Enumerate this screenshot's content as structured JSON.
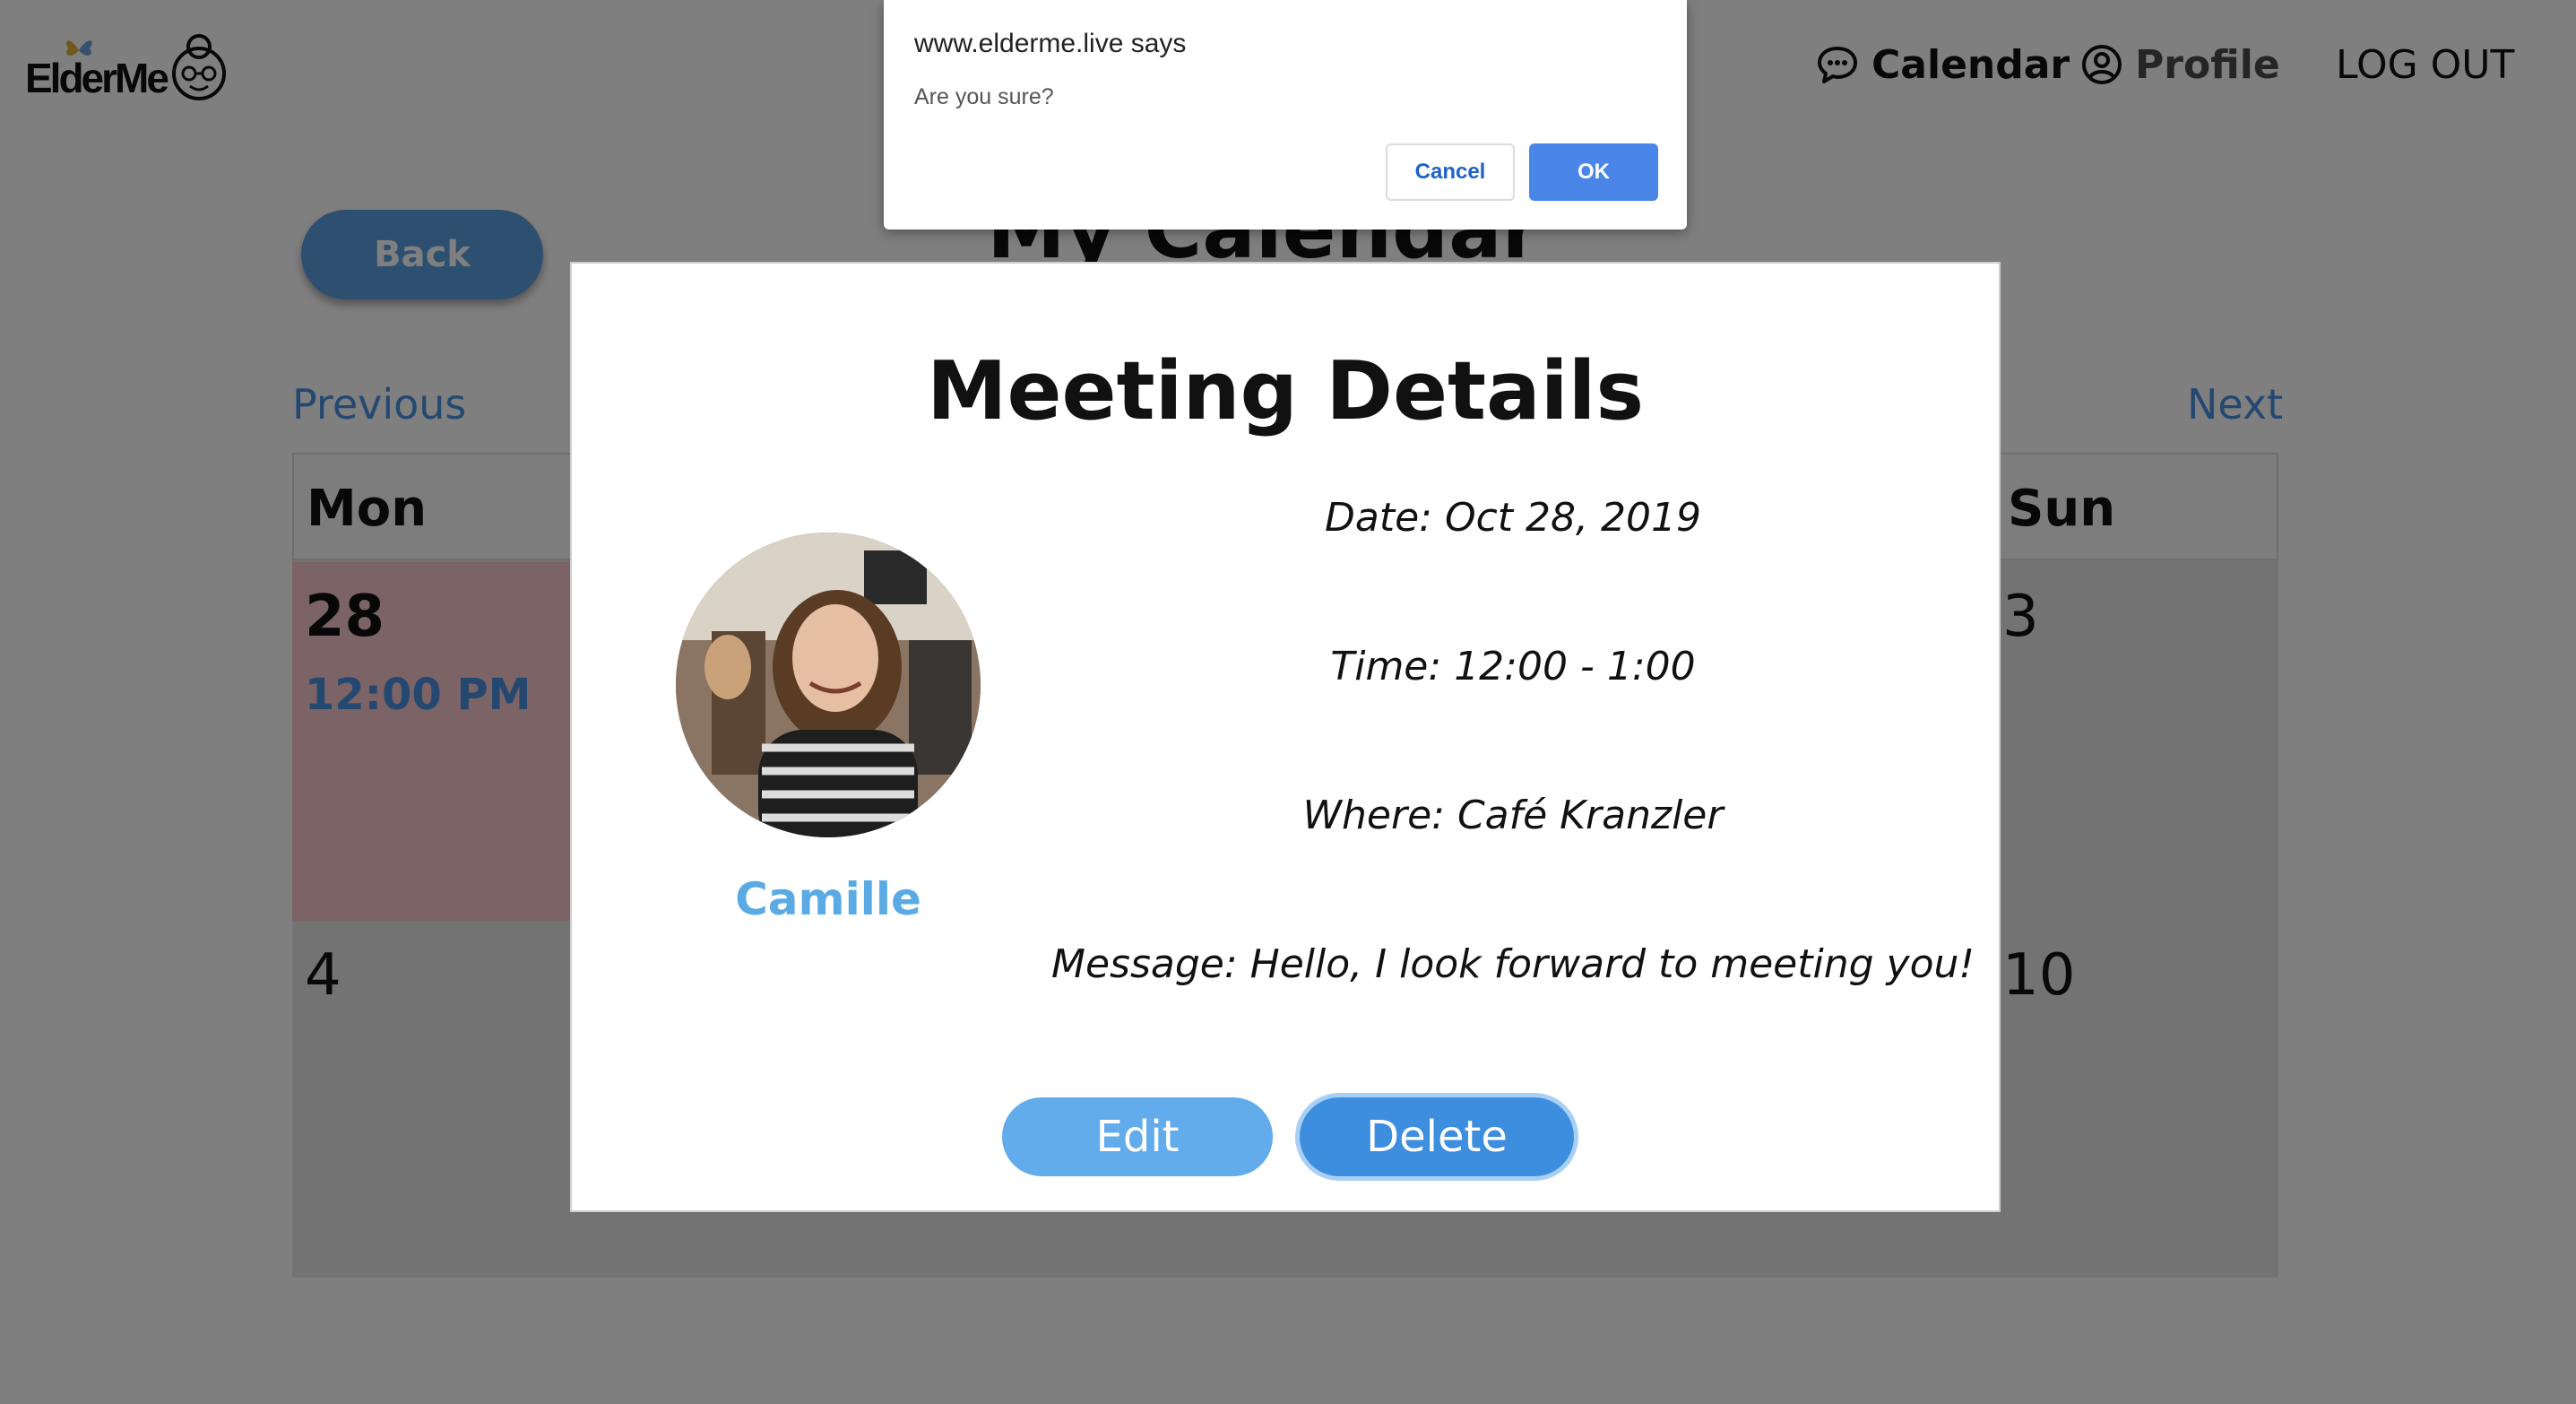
{
  "header": {
    "logo_text": "ElderMe",
    "nav": {
      "calendar_label": "Calendar",
      "profile_label": "Profile",
      "logout_label": "LOG OUT"
    }
  },
  "page": {
    "back_label": "Back",
    "title": "My Calendar",
    "prev_label": "Previous",
    "next_label": "Next"
  },
  "calendar": {
    "day_headers": [
      "Mon",
      "Sun"
    ],
    "cells": {
      "today_num": "28",
      "today_event": "12:00 PM",
      "sun1_num": "3",
      "mon2_num": "4",
      "sun2_num": "10"
    },
    "colors": {
      "today_bg": "#f7c6cc",
      "event": "#4a90e2"
    }
  },
  "modal": {
    "title": "Meeting Details",
    "person_name": "Camille",
    "date": "Date: Oct 28, 2019",
    "time": "Time: 12:00 - 1:00",
    "where": "Where: Café Kranzler",
    "message": "Message: Hello, I look forward to meeting you!",
    "edit_label": "Edit",
    "delete_label": "Delete"
  },
  "confirm_dialog": {
    "title": "www.elderme.live says",
    "message": "Are you sure?",
    "cancel_label": "Cancel",
    "ok_label": "OK"
  },
  "icons": {
    "calendar_nav": "chat-bubble-icon",
    "profile_nav": "user-circle-icon"
  },
  "colors": {
    "accent": "#4a90e2",
    "button_blue": "#5b9ee0",
    "name_blue": "#5aaae6"
  }
}
